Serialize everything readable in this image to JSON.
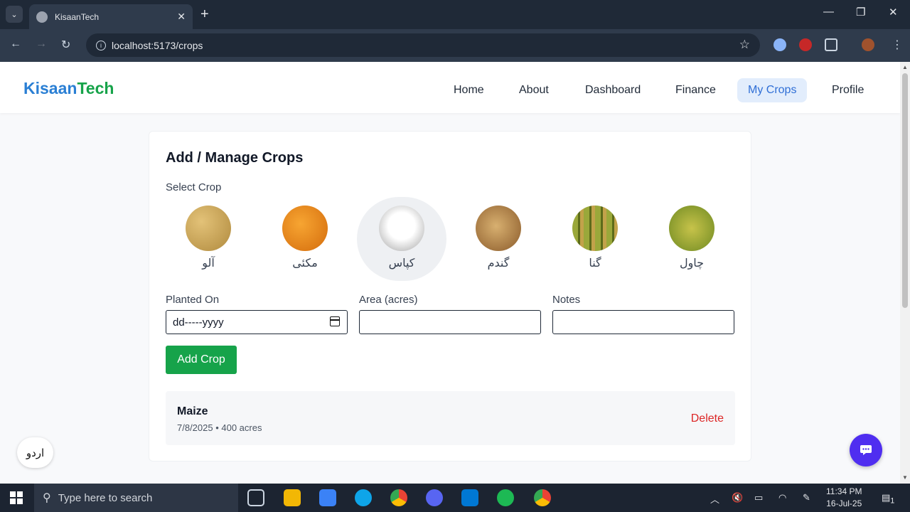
{
  "browser": {
    "tab_title": "KisaanTech",
    "url": "localhost:5173/crops"
  },
  "header": {
    "logo_part1": "Kisaan",
    "logo_part2": "Tech",
    "nav": [
      {
        "label": "Home"
      },
      {
        "label": "About"
      },
      {
        "label": "Dashboard"
      },
      {
        "label": "Finance"
      },
      {
        "label": "My Crops",
        "active": true
      },
      {
        "label": "Profile"
      }
    ]
  },
  "card": {
    "title": "Add / Manage Crops",
    "select_label": "Select Crop",
    "crops": [
      {
        "name": "آلو",
        "color": "#c9a24a"
      },
      {
        "name": "مکئی",
        "color": "#e88a1a"
      },
      {
        "name": "کپاس",
        "color": "#e8e8e8",
        "selected": true
      },
      {
        "name": "گندم",
        "color": "#b98a4a"
      },
      {
        "name": "گنا",
        "color": "#7a9a2a"
      },
      {
        "name": "چاول",
        "color": "#9aab3a"
      }
    ],
    "fields": {
      "planted_label": "Planted On",
      "planted_value": "dd-----yyyy",
      "area_label": "Area (acres)",
      "area_value": "",
      "notes_label": "Notes",
      "notes_value": ""
    },
    "add_button": "Add Crop",
    "entries": [
      {
        "title": "Maize",
        "meta": "7/8/2025 • 400 acres",
        "delete": "Delete"
      }
    ]
  },
  "lang_button": "اردو",
  "taskbar": {
    "search_placeholder": "Type here to search",
    "time": "11:34 PM",
    "date": "16-Jul-25",
    "notification_count": "1"
  }
}
